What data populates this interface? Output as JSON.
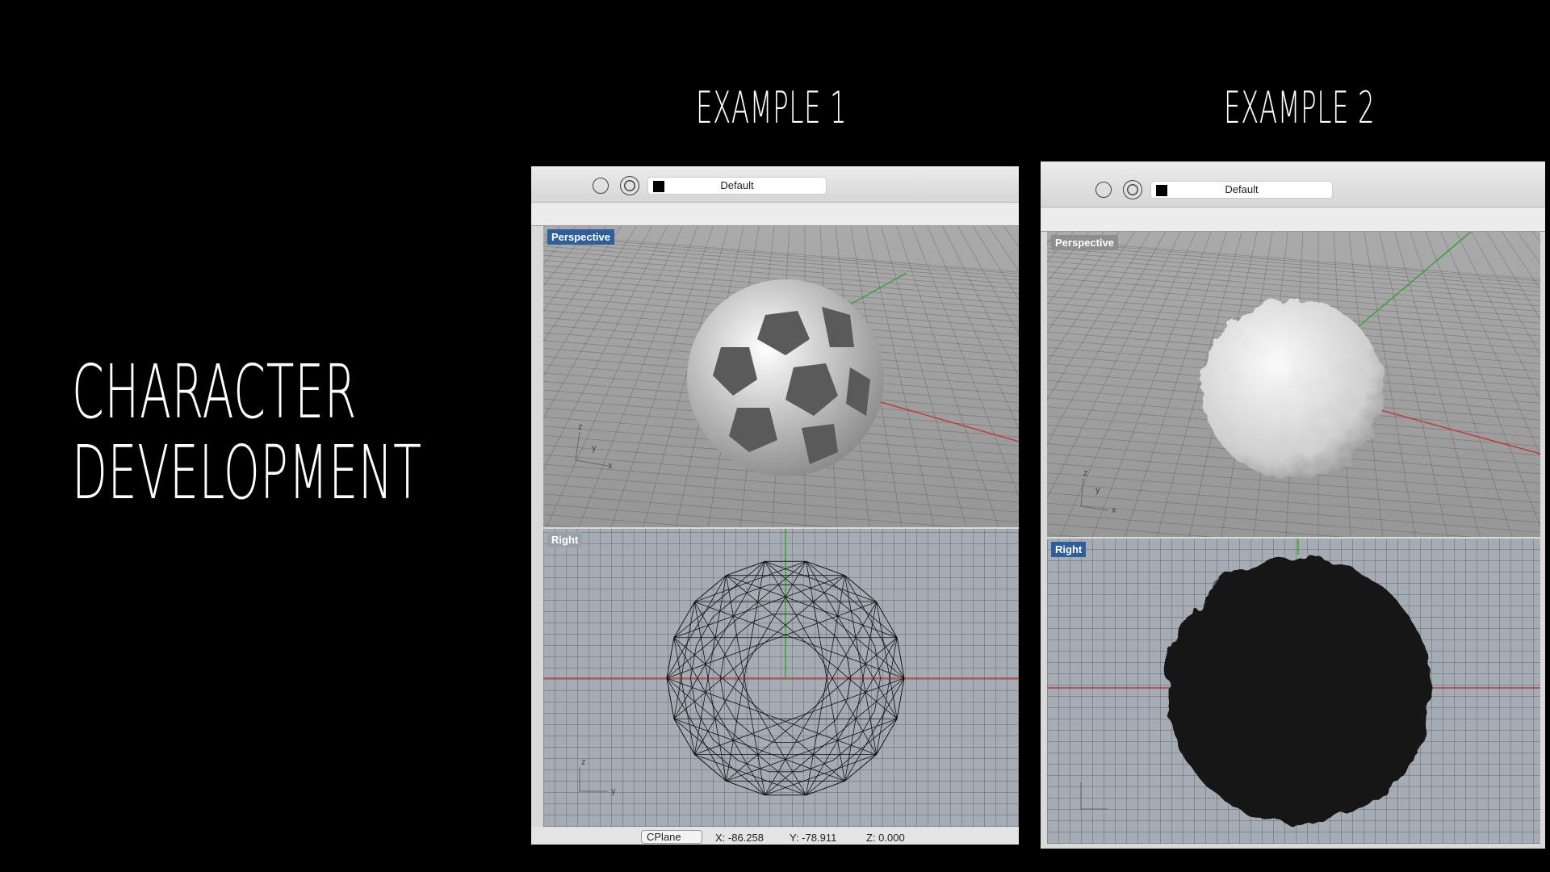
{
  "slide": {
    "title_line1": "CHARACTER",
    "title_line2": "DEVELOPMENT",
    "example1": "EXAMPLE 1",
    "example2": "EXAMPLE 2"
  },
  "example1": {
    "layer": "Default",
    "viewports": [
      {
        "label": "Perspective"
      },
      {
        "label": "Right"
      }
    ],
    "status": {
      "cplane": "CPlane",
      "x": "X: -86.258",
      "y": "Y: -78.911",
      "z": "Z: 0.000"
    }
  },
  "example2": {
    "layer": "Default",
    "viewports": [
      {
        "label": "Perspective"
      },
      {
        "label": "Right"
      }
    ]
  },
  "axis_labels": {
    "x": "x",
    "y": "y",
    "z": "z"
  },
  "colors": {
    "x_axis": "#c0393b",
    "y_axis": "#3aa13a",
    "active_label": "#2e5f9a"
  }
}
